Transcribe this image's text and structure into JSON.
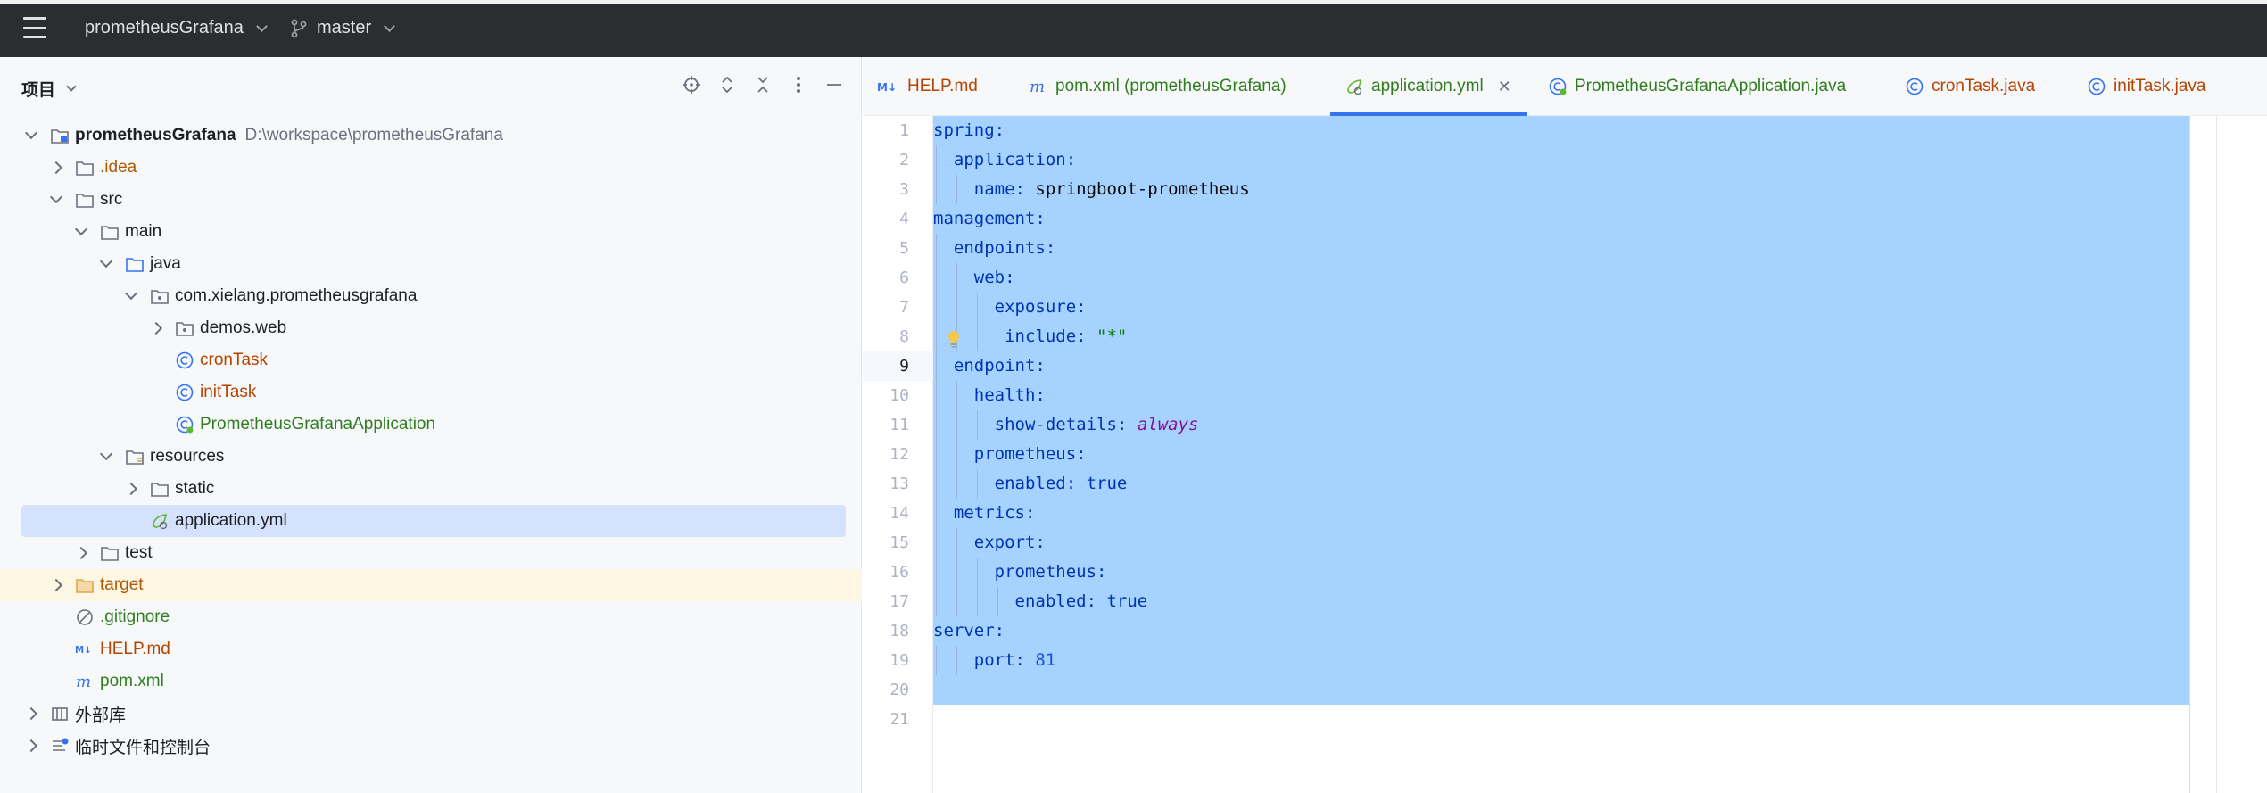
{
  "titlebar": {
    "project": "prometheusGrafana",
    "branch": "master"
  },
  "project_panel": {
    "title": "项目",
    "tree": [
      {
        "label": "prometheusGrafana",
        "path": "D:\\workspace\\prometheusGrafana"
      },
      {
        "label": ".idea"
      },
      {
        "label": "src"
      },
      {
        "label": "main"
      },
      {
        "label": "java"
      },
      {
        "label": "com.xielang.prometheusgrafana"
      },
      {
        "label": "demos.web"
      },
      {
        "label": "cronTask"
      },
      {
        "label": "initTask"
      },
      {
        "label": "PrometheusGrafanaApplication"
      },
      {
        "label": "resources"
      },
      {
        "label": "static"
      },
      {
        "label": "application.yml"
      },
      {
        "label": "test"
      },
      {
        "label": "target"
      },
      {
        "label": ".gitignore"
      },
      {
        "label": "HELP.md"
      },
      {
        "label": "pom.xml"
      },
      {
        "label": "外部库"
      },
      {
        "label": "临时文件和控制台"
      }
    ]
  },
  "tabs": [
    {
      "label": "HELP.md"
    },
    {
      "label": "pom.xml (prometheusGrafana)"
    },
    {
      "label": "application.yml",
      "active": true
    },
    {
      "label": "PrometheusGrafanaApplication.java"
    },
    {
      "label": "cronTask.java"
    },
    {
      "label": "initTask.java"
    }
  ],
  "editor": {
    "line_numbers": [
      "1",
      "2",
      "3",
      "4",
      "5",
      "6",
      "7",
      "8",
      "9",
      "10",
      "11",
      "12",
      "13",
      "14",
      "15",
      "16",
      "17",
      "18",
      "19",
      "20",
      "21"
    ],
    "current_line": "9",
    "lines": [
      {
        "key": "spring",
        "sep": ":"
      },
      {
        "indent": "  ",
        "key": "application",
        "sep": ":"
      },
      {
        "indent": "    ",
        "key": "name",
        "sep": ": ",
        "value": "springboot-prometheus"
      },
      {
        "key": "management",
        "sep": ":"
      },
      {
        "indent": "  ",
        "key": "endpoints",
        "sep": ":"
      },
      {
        "indent": "    ",
        "key": "web",
        "sep": ":"
      },
      {
        "indent": "      ",
        "key": "exposure",
        "sep": ":"
      },
      {
        "indent": "       ",
        "key": "include",
        "sep": ": ",
        "value": "\"*\""
      },
      {
        "indent": "  ",
        "key": "endpoint",
        "sep": ":"
      },
      {
        "indent": "    ",
        "key": "health",
        "sep": ":"
      },
      {
        "indent": "      ",
        "key": "show-details",
        "sep": ": ",
        "value": "always"
      },
      {
        "indent": "    ",
        "key": "prometheus",
        "sep": ":"
      },
      {
        "indent": "      ",
        "key": "enabled",
        "sep": ": ",
        "value": "true"
      },
      {
        "indent": "  ",
        "key": "metrics",
        "sep": ":"
      },
      {
        "indent": "    ",
        "key": "export",
        "sep": ":"
      },
      {
        "indent": "      ",
        "key": "prometheus",
        "sep": ":"
      },
      {
        "indent": "        ",
        "key": "enabled",
        "sep": ": ",
        "value": "true"
      },
      {
        "key": "server",
        "sep": ":"
      },
      {
        "indent": "    ",
        "key": "port",
        "sep": ": ",
        "value": "81"
      }
    ]
  },
  "colors": {
    "accent": "#3574f0",
    "selection": "#a6d2ff",
    "yaml_key": "#0033b3",
    "yaml_string": "#067d17",
    "yaml_number": "#1750eb"
  }
}
